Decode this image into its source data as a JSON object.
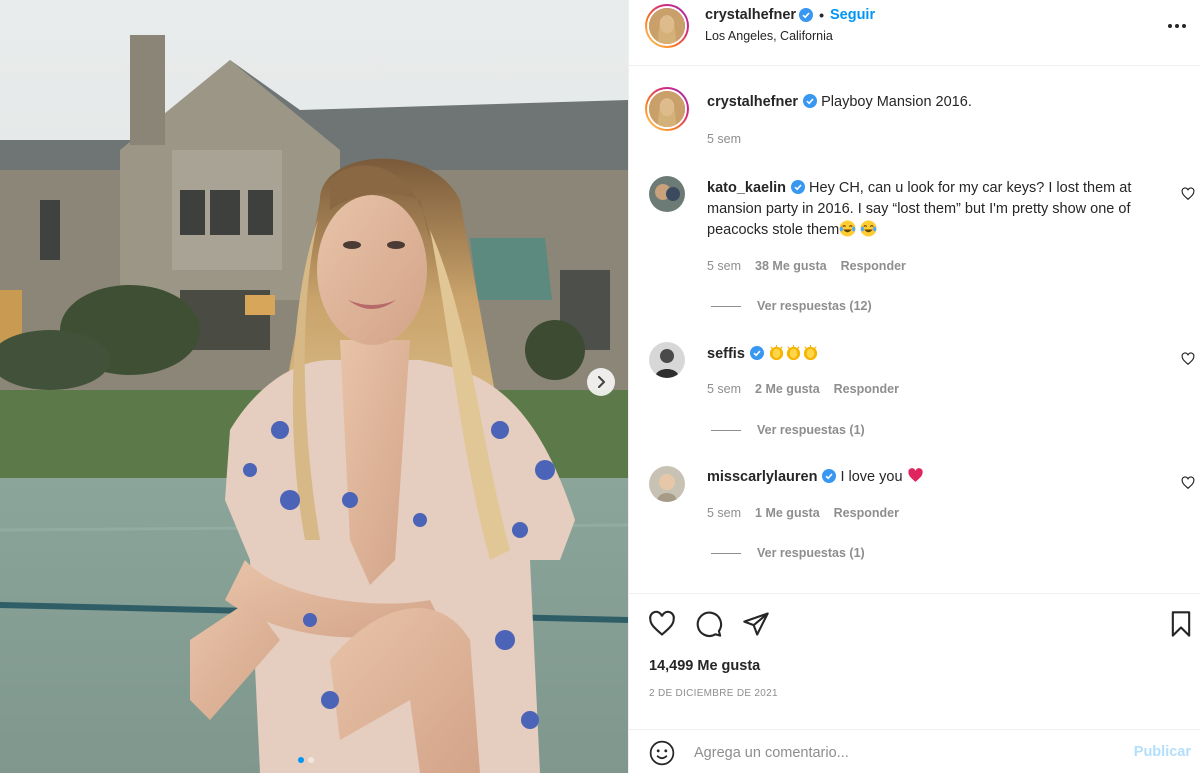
{
  "post": {
    "author": "crystalhefner",
    "follow_label": "Seguir",
    "separator": "•",
    "location": "Los Angeles, California",
    "caption_username": "crystalhefner",
    "caption_text": "Playboy Mansion 2016.",
    "caption_time": "5 sem"
  },
  "comments": [
    {
      "username": "kato_kaelin",
      "text": "Hey CH, can u look for my car keys? I lost them at mansion party in 2016. I say “lost them” but I'm pretty show one of peacocks stole them",
      "emojis": [
        "laughing-tears-emoji",
        "laughing-tears-emoji"
      ],
      "time": "5 sem",
      "likes": "38 Me gusta",
      "reply_label": "Responder",
      "view_replies": "Ver respuestas (12)"
    },
    {
      "username": "seffis",
      "text": "",
      "emojis": [
        "clapping-hands-emoji",
        "clapping-hands-emoji",
        "clapping-hands-emoji"
      ],
      "time": "5 sem",
      "likes": "2 Me gusta",
      "reply_label": "Responder",
      "view_replies": "Ver respuestas (1)"
    },
    {
      "username": "misscarlylauren",
      "text": "I love you",
      "emojis": [
        "red-heart-emoji"
      ],
      "time": "5 sem",
      "likes": "1 Me gusta",
      "reply_label": "Responder",
      "view_replies": "Ver respuestas (1)"
    }
  ],
  "footer": {
    "likes": "14,499 Me gusta",
    "date": "2 DE DICIEMBRE DE 2021",
    "comment_placeholder": "Agrega un comentario...",
    "post_label": "Publicar"
  },
  "colors": {
    "accent": "#0095f6",
    "verified": "#3897f0",
    "muted": "#8e8e8e",
    "post_disabled": "#b2dffc"
  },
  "icons": {
    "header_more": "more-horizontal-icon",
    "like": "heart-icon",
    "comment": "comment-bubble-icon",
    "share": "paper-plane-icon",
    "save": "bookmark-icon",
    "emoji": "smiley-icon",
    "carousel_next": "chevron-right-icon"
  },
  "carousel": {
    "slides": 2,
    "current": 1
  }
}
